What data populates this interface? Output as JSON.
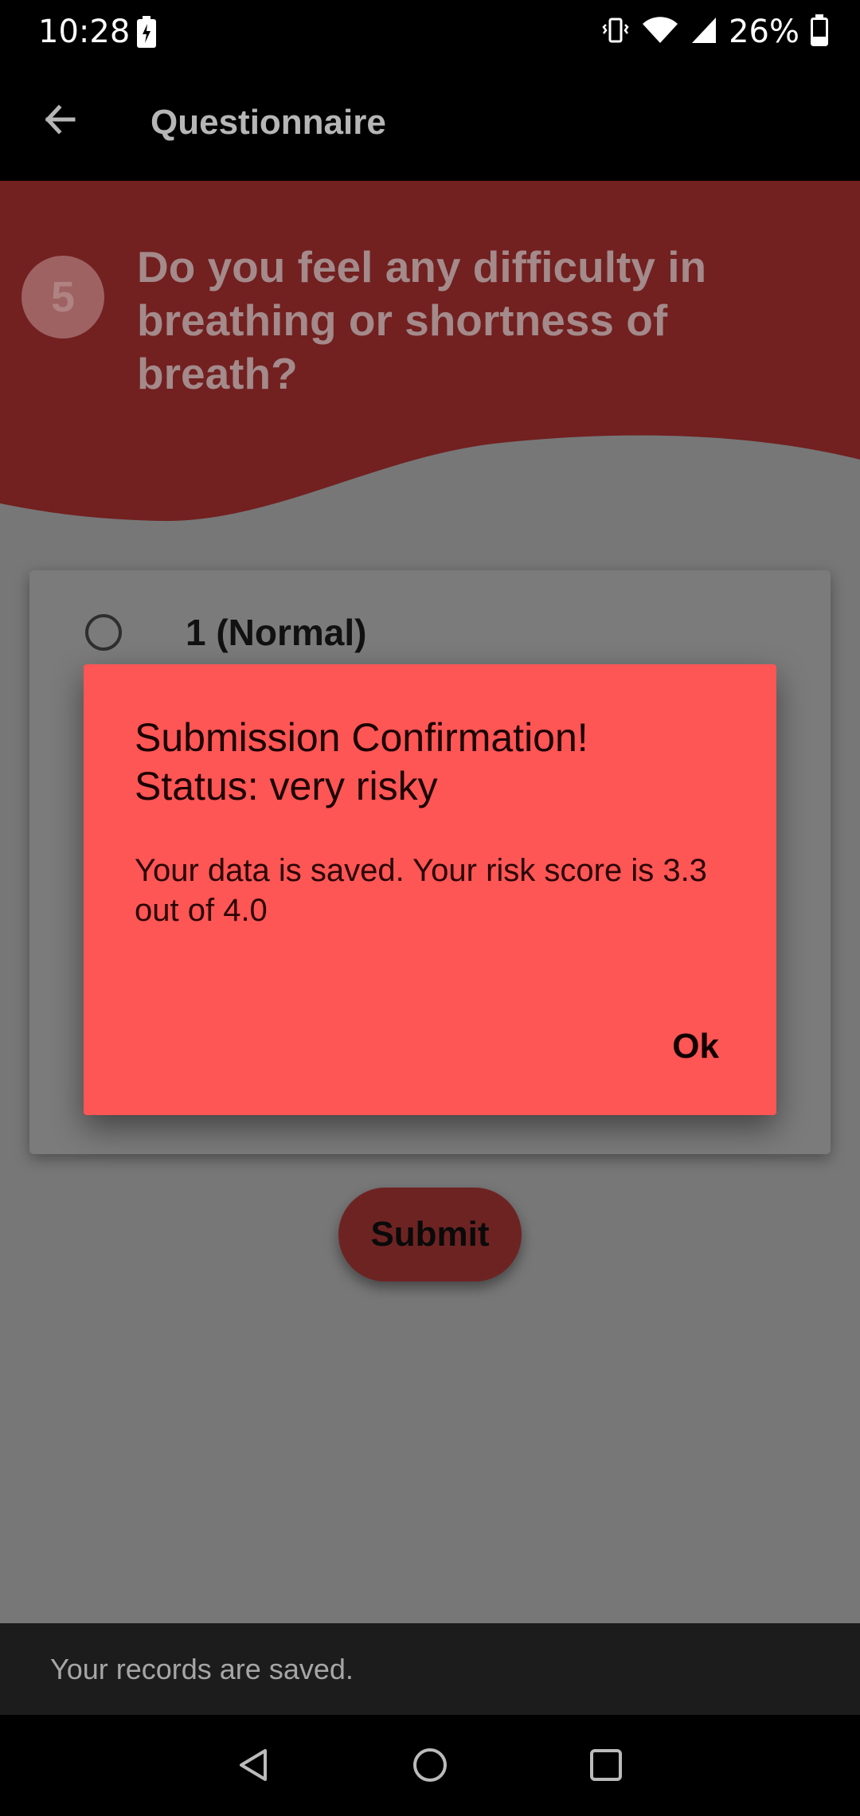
{
  "status_bar": {
    "time": "10:28",
    "battery_percent": "26%",
    "icons": [
      "battery-charging-icon",
      "vibrate-icon",
      "wifi-icon",
      "signal-icon",
      "battery-icon"
    ]
  },
  "app_bar": {
    "title": "Questionnaire",
    "back_icon": "arrow-left-icon"
  },
  "question": {
    "number": "5",
    "text": "Do you feel any difficulty in breathing or shortness of breath?"
  },
  "options": [
    {
      "label": "1 (Normal)",
      "selected": false
    }
  ],
  "submit_label": "Submit",
  "dialog": {
    "title": "Submission Confirmation!\nStatus: very risky",
    "body": "Your data is saved. Your risk score is 3.3 out of 4.0",
    "ok_label": "Ok"
  },
  "snackbar": {
    "text": "Your records are saved."
  },
  "nav_bar": {
    "icons": [
      "back-triangle-icon",
      "home-circle-icon",
      "recents-square-icon"
    ]
  },
  "colors": {
    "header_red": "#722020",
    "dialog_red": "#fe5555",
    "scrim_gray": "#777777",
    "submit_red": "#6e2323"
  }
}
